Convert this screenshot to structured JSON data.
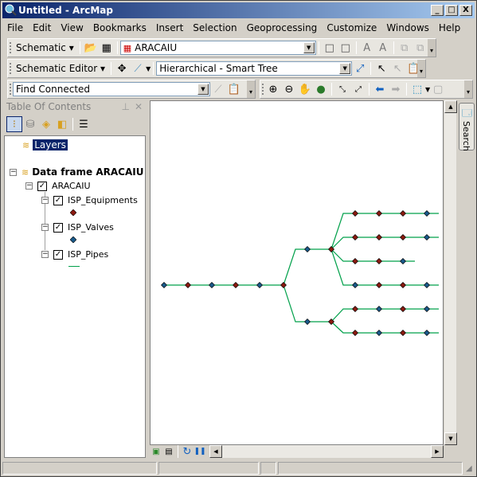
{
  "window": {
    "title": "Untitled - ArcMap",
    "buttons": [
      "_",
      "□",
      "X"
    ]
  },
  "menubar": [
    "File",
    "Edit",
    "View",
    "Bookmarks",
    "Insert",
    "Selection",
    "Geoprocessing",
    "Customize",
    "Windows",
    "Help"
  ],
  "schematic_toolbar": {
    "label": "Schematic",
    "dataset": "ARACAIU"
  },
  "editor_toolbar": {
    "label": "Schematic Editor",
    "layout": "Hierarchical - Smart Tree"
  },
  "trace_toolbar": {
    "task": "Find Connected"
  },
  "toc": {
    "title": "Table Of Contents",
    "layers_label": "Layers",
    "data_frame": "Data frame ARACAIU",
    "group": "ARACAIU",
    "layers": [
      {
        "name": "ISP_Equipments",
        "symbol": "point",
        "color": "#8b1a10"
      },
      {
        "name": "ISP_Valves",
        "symbol": "point",
        "color": "#1a5a8b"
      },
      {
        "name": "ISP_Pipes",
        "symbol": "line",
        "color": "#00a04a"
      }
    ]
  },
  "side_tab": {
    "label": "Search"
  },
  "diagram": {
    "colors": {
      "equipment": "#8b1a10",
      "valve": "#1a5a8b",
      "pipe": "#00a04a"
    },
    "trunk": [
      "V",
      "E",
      "V",
      "E",
      "V",
      "E"
    ],
    "branches": [
      {
        "mid": "V",
        "hub": "E",
        "rows": [
          [
            "E",
            "E",
            "E",
            "V"
          ],
          [
            "E",
            "E",
            "E",
            "V"
          ],
          [
            "E",
            "E",
            "V"
          ],
          [
            "V",
            "E",
            "E",
            "V"
          ]
        ]
      },
      {
        "mid": "V",
        "hub": "E",
        "rows": [
          [
            "E",
            "V",
            "E",
            "V"
          ],
          [
            "E",
            "V",
            "E",
            "V"
          ]
        ]
      }
    ]
  }
}
